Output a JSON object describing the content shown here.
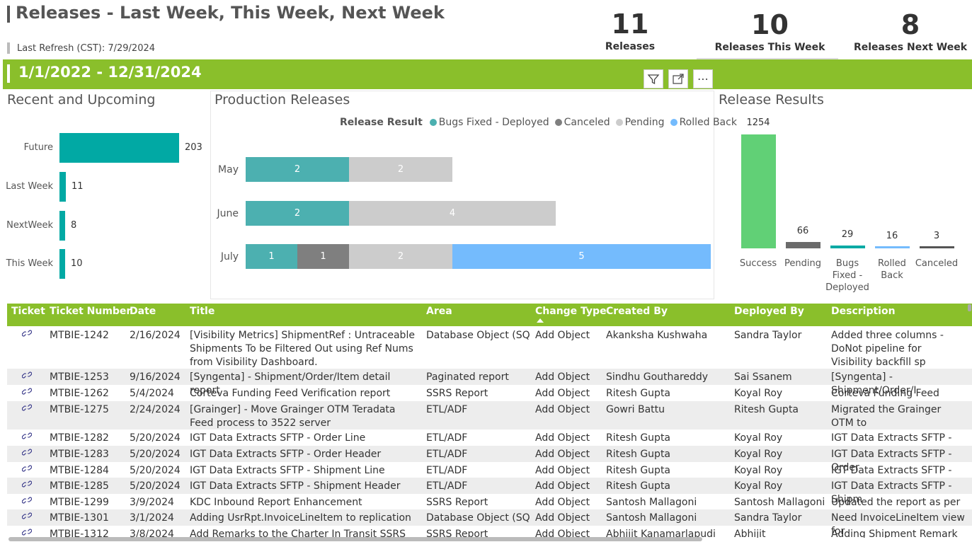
{
  "header": {
    "title": "Releases - Last Week, This Week, Next Week",
    "refresh": "Last Refresh (CST): 7/29/2024"
  },
  "kpis": [
    {
      "value": "11",
      "label": "Releases"
    },
    {
      "value": "10",
      "label": "Releases This Week"
    },
    {
      "value": "8",
      "label": "Releases Next Week"
    }
  ],
  "band": {
    "date_range": "1/1/2022 - 12/31/2024",
    "icons": [
      "filter-icon",
      "focus-mode-icon",
      "more-options-icon"
    ],
    "more_label": "⋯"
  },
  "recent_upcoming": {
    "title": "Recent and Upcoming",
    "color": "#01a9a4",
    "chart_data": {
      "type": "bar",
      "orientation": "horizontal",
      "categories": [
        "Future",
        "Last Week",
        "NextWeek",
        "This Week"
      ],
      "values": [
        203,
        11,
        8,
        10
      ]
    }
  },
  "production_releases": {
    "title": "Production Releases",
    "legend_title": "Release Result",
    "chart_data": {
      "type": "bar",
      "stacked": true,
      "orientation": "horizontal",
      "categories": [
        "May",
        "June",
        "July"
      ],
      "series": [
        {
          "name": "Bugs Fixed - Deployed",
          "color": "#4cb0b0",
          "values": [
            2,
            2,
            1
          ]
        },
        {
          "name": "Canceled",
          "color": "#7f7f7f",
          "values": [
            0,
            0,
            1
          ]
        },
        {
          "name": "Pending",
          "color": "#cccccc",
          "values": [
            2,
            4,
            2
          ]
        },
        {
          "name": "Rolled Back",
          "color": "#74bbfd",
          "values": [
            0,
            0,
            5
          ]
        }
      ],
      "xlim": [
        0,
        9
      ]
    }
  },
  "release_results": {
    "title": "Release Results",
    "chart_data": {
      "type": "bar",
      "categories": [
        "Success",
        "Pending",
        "Bugs Fixed - Deployed",
        "Rolled Back",
        "Canceled"
      ],
      "category_lines": [
        [
          "Success"
        ],
        [
          "Pending"
        ],
        [
          "Bugs",
          "Fixed -",
          "Deployed"
        ],
        [
          "Rolled",
          "Back"
        ],
        [
          "Canceled"
        ]
      ],
      "values": [
        1254,
        66,
        29,
        16,
        3
      ],
      "colors": [
        "#61d076",
        "#6b6b6b",
        "#01a9a4",
        "#74bbfd",
        "#555555"
      ]
    }
  },
  "table": {
    "columns": [
      "Ticket",
      "Ticket Number",
      "Date",
      "Title",
      "Area",
      "Change Type",
      "Created By",
      "Deployed By",
      "Description"
    ],
    "sorted_column": "Change Type",
    "rows": [
      {
        "ticket": "link-icon",
        "number": "MTBIE-1242",
        "date": "2/16/2024",
        "title": "[Visibility Metrics] ShipmentRef : Untraceable Shipments To be Filtered Out using Ref Nums from Visibility Dashboard.",
        "area": "Database Object (SQL)",
        "change": "Add Object",
        "created": "Akanksha Kushwaha",
        "deployed": "Sandra Taylor",
        "desc": "Added three columns - DoNot pipeline for Visibility backfill sp"
      },
      {
        "ticket": "link-icon",
        "number": "MTBIE-1253",
        "date": "9/16/2024",
        "title": "[Syngenta] - Shipment/Order/Item detail report",
        "area": "Paginated report",
        "change": "Add Object",
        "created": "Sindhu Gouthareddy",
        "deployed": "Sai Ssanem",
        "desc": "[Syngenta] - Shipment/Order/I"
      },
      {
        "ticket": "link-icon",
        "number": "MTBIE-1262",
        "date": "5/4/2024",
        "title": "Corteva Funding Feed Verification report",
        "area": "SSRS Report",
        "change": "Add Object",
        "created": "Ritesh Gupta",
        "deployed": "Koyal Roy",
        "desc": "Corteva Funding Feed Verificat"
      },
      {
        "ticket": "link-icon",
        "number": "MTBIE-1275",
        "date": "2/24/2024",
        "title": "[Grainger] - Move Grainger OTM Teradata Feed process to 3522 server",
        "area": "ETL/ADF",
        "change": "Add Object",
        "created": "Gowri Battu",
        "deployed": "Ritesh Gupta",
        "desc": "Migrated the Grainger OTM to"
      },
      {
        "ticket": "link-icon",
        "number": "MTBIE-1282",
        "date": "5/20/2024",
        "title": "IGT Data Extracts SFTP - Order Line",
        "area": "ETL/ADF",
        "change": "Add Object",
        "created": "Ritesh Gupta",
        "deployed": "Koyal Roy",
        "desc": "IGT Data Extracts SFTP - Order"
      },
      {
        "ticket": "link-icon",
        "number": "MTBIE-1283",
        "date": "5/20/2024",
        "title": "IGT Data Extracts SFTP - Order Header",
        "area": "ETL/ADF",
        "change": "Add Object",
        "created": "Ritesh Gupta",
        "deployed": "Koyal Roy",
        "desc": "IGT Data Extracts SFTP - Order"
      },
      {
        "ticket": "link-icon",
        "number": "MTBIE-1284",
        "date": "5/20/2024",
        "title": "IGT Data Extracts SFTP - Shipment Line",
        "area": "ETL/ADF",
        "change": "Add Object",
        "created": "Ritesh Gupta",
        "deployed": "Koyal Roy",
        "desc": "IGT Data Extracts SFTP - Shipm"
      },
      {
        "ticket": "link-icon",
        "number": "MTBIE-1285",
        "date": "5/20/2024",
        "title": "IGT Data Extracts SFTP - Shipment Header",
        "area": "ETL/ADF",
        "change": "Add Object",
        "created": "Ritesh Gupta",
        "deployed": "Koyal Roy",
        "desc": "IGT Data Extracts SFTP - Shipm"
      },
      {
        "ticket": "link-icon",
        "number": "MTBIE-1299",
        "date": "3/9/2024",
        "title": "KDC Inbound Report Enhancement",
        "area": "SSRS Report",
        "change": "Add Object",
        "created": "Santosh Mallagoni",
        "deployed": "Santosh Mallagoni",
        "desc": "Updated the report as per requ"
      },
      {
        "ticket": "link-icon",
        "number": "MTBIE-1301",
        "date": "3/1/2024",
        "title": "Adding UsrRpt.InvoiceLineItem to replication",
        "area": "Database Object (SQL)",
        "change": "Add Object",
        "created": "Santosh Mallagoni",
        "deployed": "Sandra Taylor",
        "desc": "Need InvoiceLineItem view for"
      },
      {
        "ticket": "link-icon",
        "number": "MTBIE-1312",
        "date": "3/8/2024",
        "title": "Add Remarks to the Charter In Transit SSRS report",
        "area": "SSRS Report",
        "change": "Add Object",
        "created": "Abhijit Kanamarlapudi",
        "deployed": "Abhijit",
        "desc": "Adding Shipment Remark colu"
      }
    ]
  }
}
